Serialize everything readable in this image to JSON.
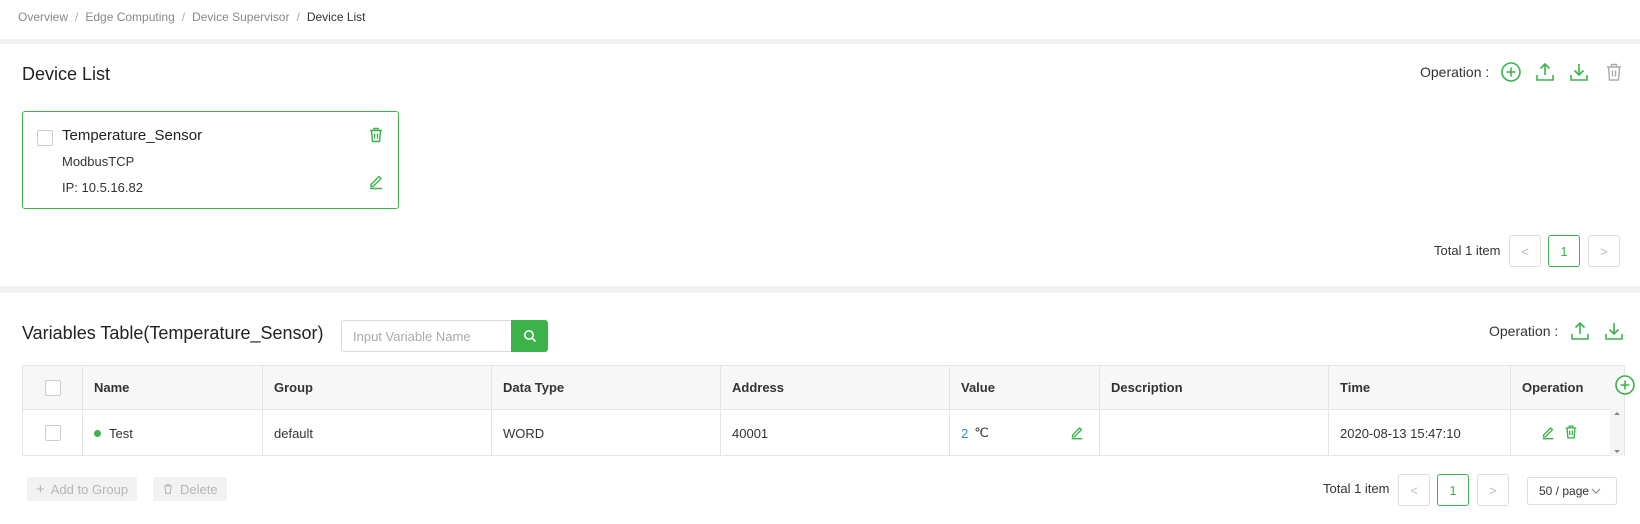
{
  "breadcrumb": {
    "items": [
      "Overview",
      "Edge Computing",
      "Device Supervisor"
    ],
    "current": "Device List",
    "separator": "/"
  },
  "device_list": {
    "title": "Device List",
    "operation_label": "Operation :",
    "icons": [
      "add-circle-icon",
      "upload-icon",
      "download-icon",
      "trash-icon"
    ],
    "card": {
      "name": "Temperature_Sensor",
      "protocol": "ModbusTCP",
      "ip": "IP: 10.5.16.82"
    },
    "pagination": {
      "total": "Total 1 item",
      "page": "1",
      "prev": "<",
      "next": ">"
    }
  },
  "variables": {
    "title": "Variables Table(Temperature_Sensor)",
    "search_placeholder": "Input Variable Name",
    "operation_label": "Operation :",
    "columns": [
      "Name",
      "Group",
      "Data Type",
      "Address",
      "Value",
      "Description",
      "Time",
      "Operation"
    ],
    "rows": [
      {
        "name": "Test",
        "group": "default",
        "data_type": "WORD",
        "address": "40001",
        "value": "2",
        "unit": "℃",
        "description": "",
        "time": "2020-08-13 15:47:10"
      }
    ],
    "add_to_group_label": "Add to Group",
    "delete_label": "Delete",
    "pagination": {
      "total": "Total 1 item",
      "page": "1",
      "prev": "<",
      "next": ">",
      "page_size": "50 / page"
    }
  },
  "colors": {
    "accent": "#3bb34a",
    "value_blue": "#2a8fd8",
    "border": "#e4e4e4",
    "section_gap": "#f0f1f2"
  }
}
